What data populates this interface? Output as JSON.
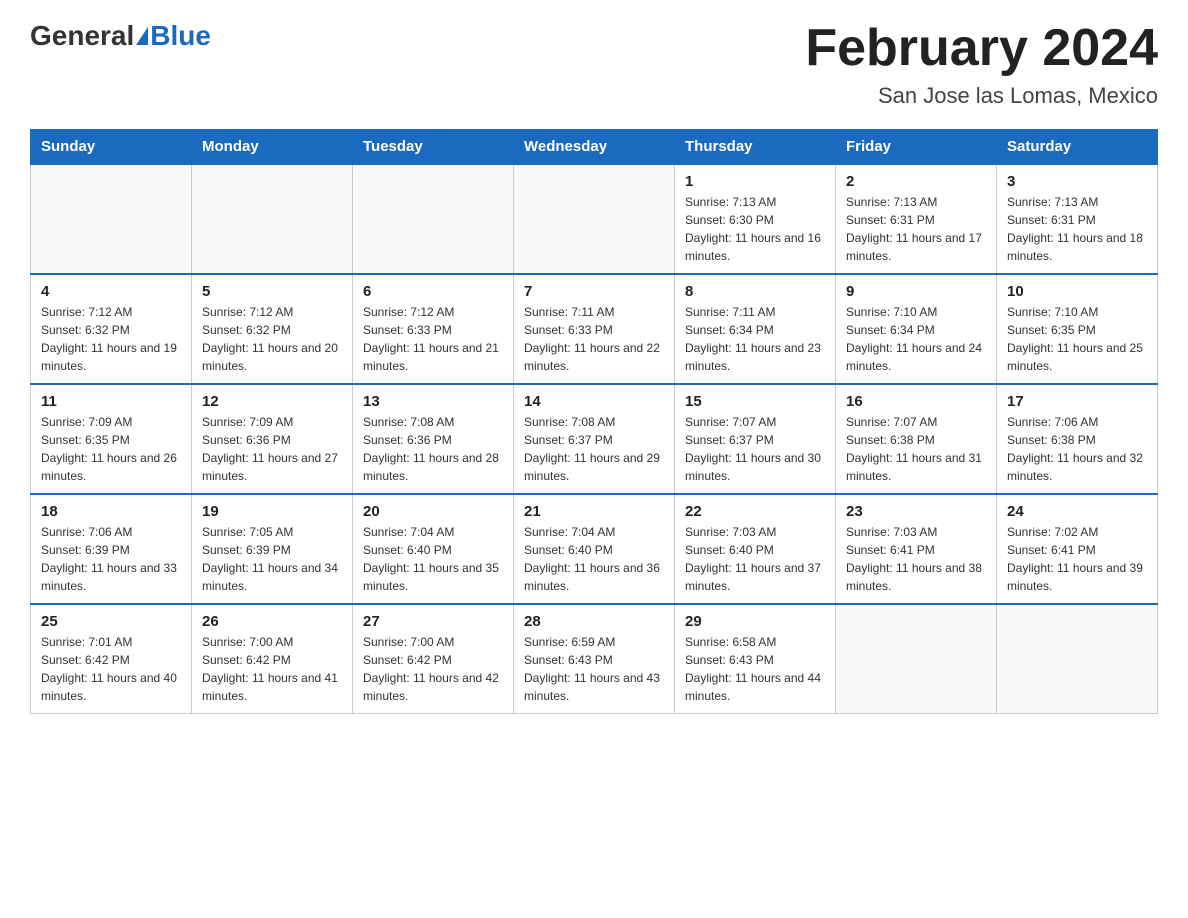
{
  "header": {
    "logo_general": "General",
    "logo_blue": "Blue",
    "month_title": "February 2024",
    "location": "San Jose las Lomas, Mexico"
  },
  "days_of_week": [
    "Sunday",
    "Monday",
    "Tuesday",
    "Wednesday",
    "Thursday",
    "Friday",
    "Saturday"
  ],
  "weeks": [
    [
      {
        "day": "",
        "info": ""
      },
      {
        "day": "",
        "info": ""
      },
      {
        "day": "",
        "info": ""
      },
      {
        "day": "",
        "info": ""
      },
      {
        "day": "1",
        "info": "Sunrise: 7:13 AM\nSunset: 6:30 PM\nDaylight: 11 hours and 16 minutes."
      },
      {
        "day": "2",
        "info": "Sunrise: 7:13 AM\nSunset: 6:31 PM\nDaylight: 11 hours and 17 minutes."
      },
      {
        "day": "3",
        "info": "Sunrise: 7:13 AM\nSunset: 6:31 PM\nDaylight: 11 hours and 18 minutes."
      }
    ],
    [
      {
        "day": "4",
        "info": "Sunrise: 7:12 AM\nSunset: 6:32 PM\nDaylight: 11 hours and 19 minutes."
      },
      {
        "day": "5",
        "info": "Sunrise: 7:12 AM\nSunset: 6:32 PM\nDaylight: 11 hours and 20 minutes."
      },
      {
        "day": "6",
        "info": "Sunrise: 7:12 AM\nSunset: 6:33 PM\nDaylight: 11 hours and 21 minutes."
      },
      {
        "day": "7",
        "info": "Sunrise: 7:11 AM\nSunset: 6:33 PM\nDaylight: 11 hours and 22 minutes."
      },
      {
        "day": "8",
        "info": "Sunrise: 7:11 AM\nSunset: 6:34 PM\nDaylight: 11 hours and 23 minutes."
      },
      {
        "day": "9",
        "info": "Sunrise: 7:10 AM\nSunset: 6:34 PM\nDaylight: 11 hours and 24 minutes."
      },
      {
        "day": "10",
        "info": "Sunrise: 7:10 AM\nSunset: 6:35 PM\nDaylight: 11 hours and 25 minutes."
      }
    ],
    [
      {
        "day": "11",
        "info": "Sunrise: 7:09 AM\nSunset: 6:35 PM\nDaylight: 11 hours and 26 minutes."
      },
      {
        "day": "12",
        "info": "Sunrise: 7:09 AM\nSunset: 6:36 PM\nDaylight: 11 hours and 27 minutes."
      },
      {
        "day": "13",
        "info": "Sunrise: 7:08 AM\nSunset: 6:36 PM\nDaylight: 11 hours and 28 minutes."
      },
      {
        "day": "14",
        "info": "Sunrise: 7:08 AM\nSunset: 6:37 PM\nDaylight: 11 hours and 29 minutes."
      },
      {
        "day": "15",
        "info": "Sunrise: 7:07 AM\nSunset: 6:37 PM\nDaylight: 11 hours and 30 minutes."
      },
      {
        "day": "16",
        "info": "Sunrise: 7:07 AM\nSunset: 6:38 PM\nDaylight: 11 hours and 31 minutes."
      },
      {
        "day": "17",
        "info": "Sunrise: 7:06 AM\nSunset: 6:38 PM\nDaylight: 11 hours and 32 minutes."
      }
    ],
    [
      {
        "day": "18",
        "info": "Sunrise: 7:06 AM\nSunset: 6:39 PM\nDaylight: 11 hours and 33 minutes."
      },
      {
        "day": "19",
        "info": "Sunrise: 7:05 AM\nSunset: 6:39 PM\nDaylight: 11 hours and 34 minutes."
      },
      {
        "day": "20",
        "info": "Sunrise: 7:04 AM\nSunset: 6:40 PM\nDaylight: 11 hours and 35 minutes."
      },
      {
        "day": "21",
        "info": "Sunrise: 7:04 AM\nSunset: 6:40 PM\nDaylight: 11 hours and 36 minutes."
      },
      {
        "day": "22",
        "info": "Sunrise: 7:03 AM\nSunset: 6:40 PM\nDaylight: 11 hours and 37 minutes."
      },
      {
        "day": "23",
        "info": "Sunrise: 7:03 AM\nSunset: 6:41 PM\nDaylight: 11 hours and 38 minutes."
      },
      {
        "day": "24",
        "info": "Sunrise: 7:02 AM\nSunset: 6:41 PM\nDaylight: 11 hours and 39 minutes."
      }
    ],
    [
      {
        "day": "25",
        "info": "Sunrise: 7:01 AM\nSunset: 6:42 PM\nDaylight: 11 hours and 40 minutes."
      },
      {
        "day": "26",
        "info": "Sunrise: 7:00 AM\nSunset: 6:42 PM\nDaylight: 11 hours and 41 minutes."
      },
      {
        "day": "27",
        "info": "Sunrise: 7:00 AM\nSunset: 6:42 PM\nDaylight: 11 hours and 42 minutes."
      },
      {
        "day": "28",
        "info": "Sunrise: 6:59 AM\nSunset: 6:43 PM\nDaylight: 11 hours and 43 minutes."
      },
      {
        "day": "29",
        "info": "Sunrise: 6:58 AM\nSunset: 6:43 PM\nDaylight: 11 hours and 44 minutes."
      },
      {
        "day": "",
        "info": ""
      },
      {
        "day": "",
        "info": ""
      }
    ]
  ]
}
